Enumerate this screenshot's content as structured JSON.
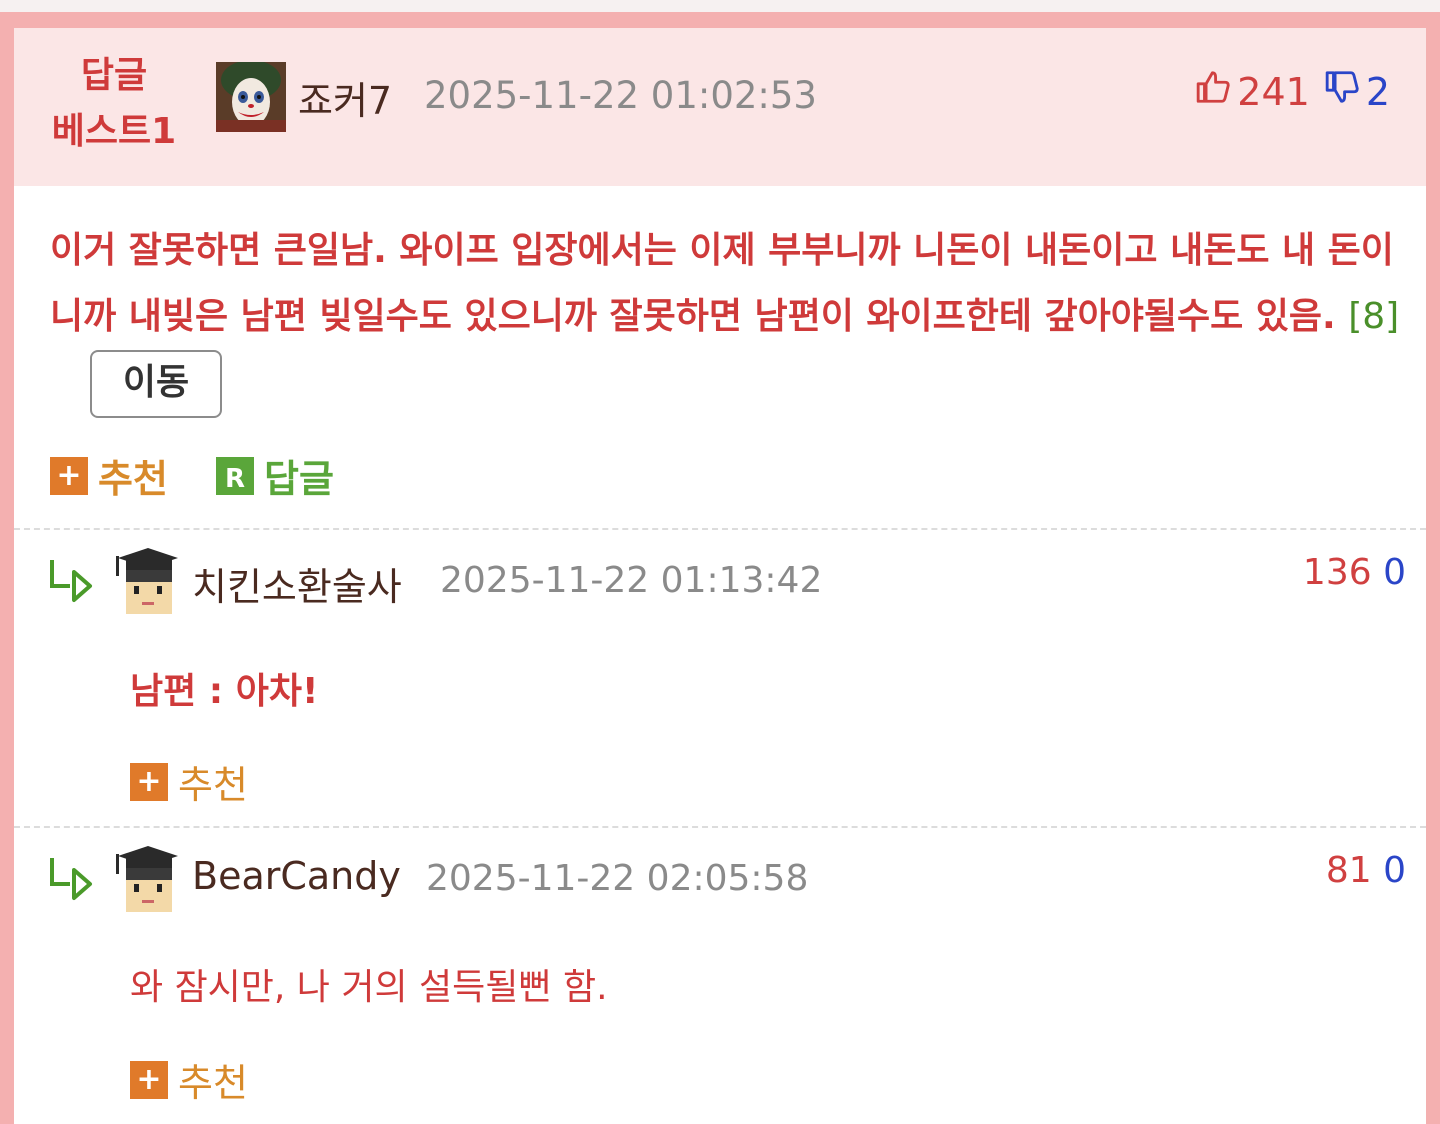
{
  "best_comment": {
    "label_line1": "답글",
    "label_line2": "베스트1",
    "nickname": "죠커7",
    "datetime": "2025-11-22 01:02:53",
    "upvotes": "241",
    "downvotes": "2",
    "text": "이거 잘못하면 큰일남. 와이프 입장에서는 이제 부부니까 니돈이 내돈이고 내돈도 내 돈이니까 내빚은 남편 빚일수도 있으니까 잘못하면 남편이 와이프한테 갚아야될수도 있음.",
    "ref": "[8]",
    "move_button": "이동",
    "recommend_label": "추천",
    "reply_label": "답글",
    "reply_icon_letter": "R"
  },
  "replies": [
    {
      "nickname": "치킨소환술사",
      "datetime": "2025-11-22 01:13:42",
      "upvotes": "136",
      "downvotes": "0",
      "text": "남편 : 아차!",
      "recommend_label": "추천"
    },
    {
      "nickname": "BearCandy",
      "datetime": "2025-11-22 02:05:58",
      "upvotes": "81",
      "downvotes": "0",
      "text": "와 잠시만, 나 거의 설득될뻔 함.",
      "recommend_label": "추천"
    }
  ],
  "icons": {
    "thumbs_up": "thumbs-up-icon",
    "thumbs_down": "thumbs-down-icon",
    "plus": "plus-icon",
    "reply_arrow": "reply-arrow-icon"
  },
  "colors": {
    "frame": "#f4b0b0",
    "best_header_bg": "#fbe6e6",
    "accent_red": "#cf3a3a",
    "down_blue": "#2a45c8",
    "recommend_orange": "#e07a2a",
    "reply_green": "#5aa63a"
  }
}
